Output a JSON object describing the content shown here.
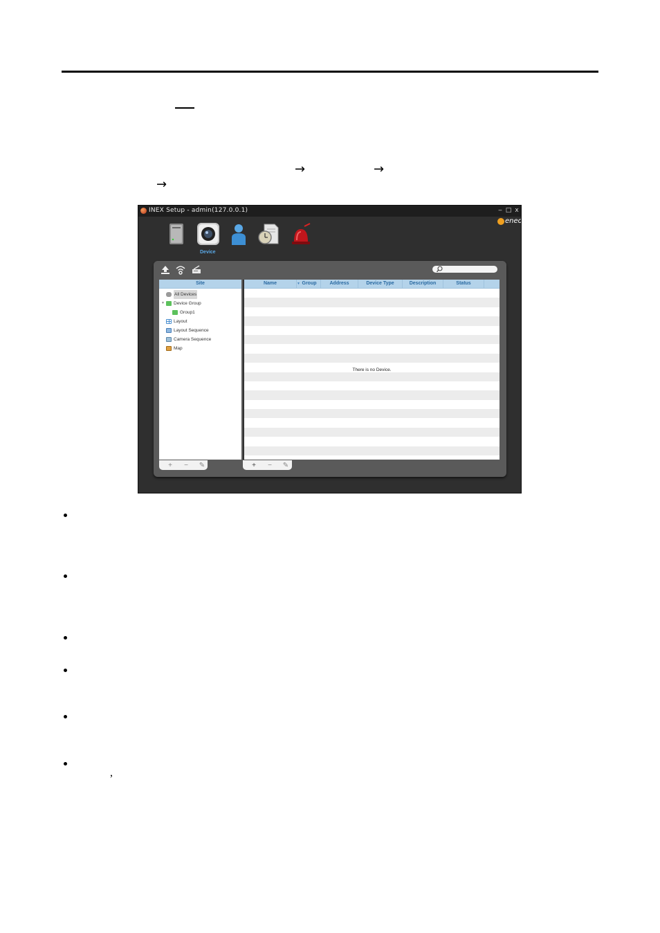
{
  "document": {
    "arrows": [
      "→",
      "→",
      "→"
    ],
    "comma": ","
  },
  "window": {
    "title": "INEX Setup - admin(127.0.0.1)",
    "controls": {
      "minimize": "‒",
      "maximize": "□",
      "close": "x"
    },
    "logo_text": "eneo"
  },
  "toolbar": {
    "items": [
      {
        "icon": "server-icon"
      },
      {
        "icon": "camera-icon",
        "label": "Device"
      },
      {
        "icon": "user-icon"
      },
      {
        "icon": "schedule-icon"
      },
      {
        "icon": "alarm-icon"
      }
    ]
  },
  "panel": {
    "tools": [
      "upload-icon",
      "wireless-icon",
      "scanner-icon"
    ],
    "search": {
      "placeholder": "",
      "icon": "search-icon"
    },
    "site": {
      "header": "Site",
      "tree": [
        {
          "label": "All Devices",
          "icon": "all-devices-icon",
          "selected": true
        },
        {
          "label": "Device Group",
          "icon": "device-group-icon",
          "expandable": true
        },
        {
          "label": "Group1",
          "icon": "group-icon"
        },
        {
          "label": "Layout",
          "icon": "layout-icon"
        },
        {
          "label": "Layout Sequence",
          "icon": "layout-sequence-icon"
        },
        {
          "label": "Camera Sequence",
          "icon": "camera-sequence-icon"
        },
        {
          "label": "Map",
          "icon": "map-icon"
        }
      ],
      "buttons": [
        "+",
        "−",
        "✎"
      ]
    },
    "devices": {
      "columns": [
        "Name",
        "Group",
        "Address",
        "Device Type",
        "Description",
        "Status"
      ],
      "empty_message": "There is no Device.",
      "buttons": [
        "+",
        "−",
        "✎"
      ]
    }
  },
  "colors": {
    "accent": "#5aa8e6",
    "header_bg": "#b4d3ea",
    "window_bg": "#2f2f2f",
    "panel_bg": "#5a5a5a"
  }
}
